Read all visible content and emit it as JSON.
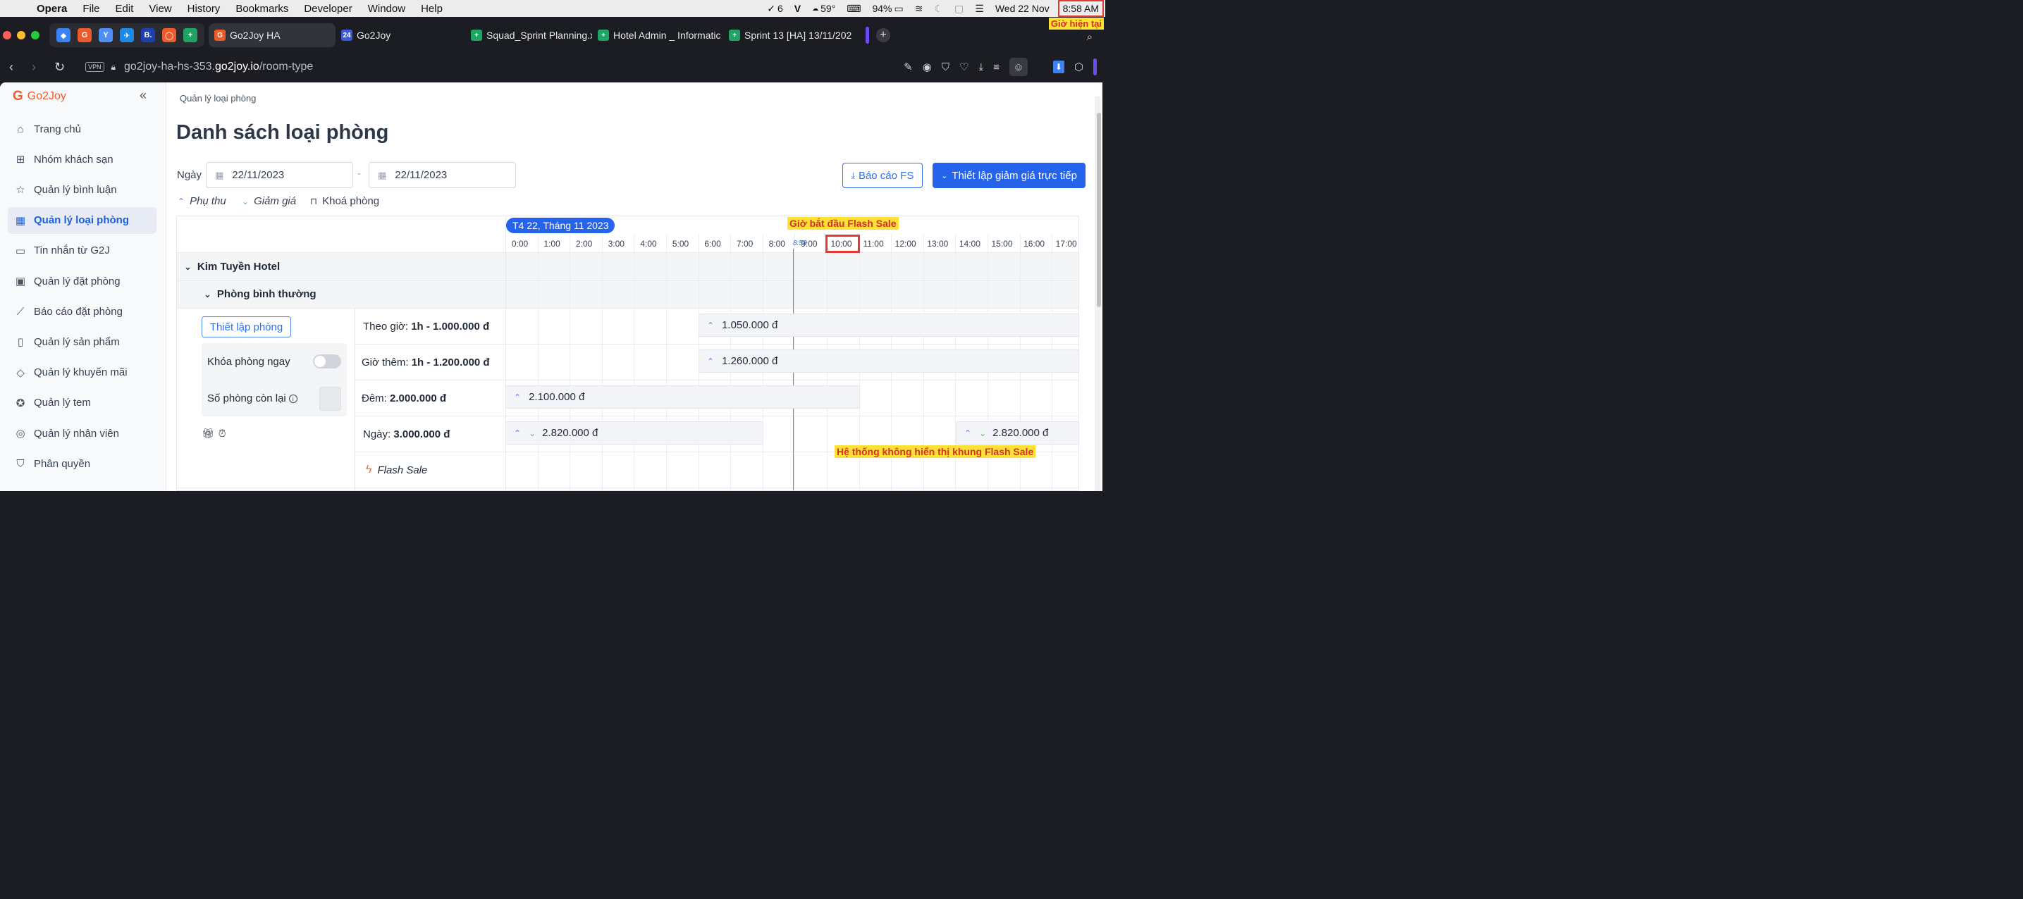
{
  "menubar": {
    "app_name": "Opera",
    "items": [
      "File",
      "Edit",
      "View",
      "History",
      "Bookmarks",
      "Developer",
      "Window",
      "Help"
    ],
    "tasks_count": "6",
    "temperature": "59°",
    "battery": "94%",
    "date": "Wed 22 Nov",
    "time": "8:58 AM"
  },
  "annotations": {
    "current_time": "Giờ hiện tại",
    "flash_start": "Giờ bắt đầu Flash Sale",
    "no_flash": "Hệ thống không hiển thị khung Flash Sale"
  },
  "tabs": [
    {
      "title": "Go2Joy HA",
      "fav_text": "G",
      "fav_color": "#ef5a2b",
      "active": true
    },
    {
      "title": "Go2Joy",
      "fav_text": "24",
      "fav_color": "#3b5bdb",
      "active": false
    },
    {
      "title": "Squad_Sprint Planning.x",
      "fav_text": "+",
      "fav_color": "#21a366",
      "active": false
    },
    {
      "title": "Hotel Admin _ Informatic",
      "fav_text": "+",
      "fav_color": "#21a366",
      "active": false
    },
    {
      "title": "Sprint 13 [HA] 13/11/202",
      "fav_text": "+",
      "fav_color": "#21a366",
      "active": false
    }
  ],
  "pinned_tabs": [
    {
      "text": "◆",
      "color": "#3b82f6"
    },
    {
      "text": "G",
      "color": "#ef5a2b"
    },
    {
      "text": "Y",
      "color": "#4f8ef7"
    },
    {
      "text": "✈",
      "color": "#1e88e5"
    },
    {
      "text": "B.",
      "color": "#1e40af"
    },
    {
      "text": "◯",
      "color": "#ef5a2b"
    },
    {
      "text": "+",
      "color": "#21a366"
    }
  ],
  "address": {
    "vpn": "VPN",
    "url_prefix": "go2joy-ha-hs-353.",
    "url_domain": "go2joy.io",
    "url_path": "/room-type"
  },
  "brand": "Go2Joy",
  "sidebar": {
    "items": [
      {
        "label": "Trang chủ",
        "icon": "home-icon",
        "glyph": "⌂",
        "active": false
      },
      {
        "label": "Nhóm khách sạn",
        "icon": "grid-icon",
        "glyph": "⊞",
        "active": false
      },
      {
        "label": "Quản lý bình luận",
        "icon": "star-icon",
        "glyph": "☆",
        "active": false
      },
      {
        "label": "Quản lý loại phòng",
        "icon": "building-icon",
        "glyph": "▦",
        "active": true
      },
      {
        "label": "Tin nhắn từ G2J",
        "icon": "message-icon",
        "glyph": "▭",
        "active": false
      },
      {
        "label": "Quản lý đặt phòng",
        "icon": "calendar-check-icon",
        "glyph": "▣",
        "active": false
      },
      {
        "label": "Báo cáo đặt phòng",
        "icon": "chart-line-icon",
        "glyph": "⟋",
        "active": false
      },
      {
        "label": "Quản lý sản phẩm",
        "icon": "bottle-icon",
        "glyph": "▯",
        "active": false
      },
      {
        "label": "Quản lý khuyến mãi",
        "icon": "tag-icon",
        "glyph": "◇",
        "active": false
      },
      {
        "label": "Quản lý tem",
        "icon": "stamp-icon",
        "glyph": "✪",
        "active": false
      },
      {
        "label": "Quản lý nhân viên",
        "icon": "user-shield-icon",
        "glyph": "◎",
        "active": false
      },
      {
        "label": "Phân quyền",
        "icon": "shield-icon",
        "glyph": "⛉",
        "active": false
      }
    ]
  },
  "page": {
    "breadcrumb": "Quản lý loại phòng",
    "title": "Danh sách loại phòng",
    "date_label": "Ngày",
    "date_from": "22/11/2023",
    "date_to": "22/11/2023",
    "date_separator": "-",
    "report_button": "Báo cáo FS",
    "discount_button": "Thiết lập giảm giá trực tiếp",
    "legend": {
      "surcharge": "Phụ thu",
      "discount": "Giảm giá",
      "lock": "Khoá phòng"
    }
  },
  "timeline": {
    "date_pill": "T4 22, Tháng 11 2023",
    "now_label": "8:58",
    "hours": [
      "0:00",
      "1:00",
      "2:00",
      "3:00",
      "4:00",
      "5:00",
      "6:00",
      "7:00",
      "8:00",
      "9:00",
      "10:00",
      "11:00",
      "12:00",
      "13:00",
      "14:00",
      "15:00",
      "16:00",
      "17:00"
    ],
    "highlighted_hour": "10:00"
  },
  "hotel": {
    "name": "Kim Tuyền Hotel",
    "room_type": "Phòng bình thường",
    "setup_button": "Thiết lập phòng",
    "lock_now": "Khóa phòng ngay",
    "lock_enabled": false,
    "rooms_left_label": "Số phòng còn lại",
    "rates": [
      {
        "label": "Theo giờ:",
        "value": "1h - 1.000.000 đ"
      },
      {
        "label": "Giờ thêm:",
        "value": "1h - 1.200.000 đ"
      },
      {
        "label": "Đêm:",
        "value": "2.000.000 đ"
      },
      {
        "label": "Ngày:",
        "value": "3.000.000 đ"
      }
    ],
    "flash_sale_label": "Flash Sale",
    "price_bars": [
      {
        "price": "1.050.000 đ"
      },
      {
        "price": "1.260.000 đ"
      },
      {
        "price": "2.100.000 đ"
      },
      {
        "price": "2.820.000 đ"
      },
      {
        "price": "2.820.000 đ"
      }
    ]
  }
}
